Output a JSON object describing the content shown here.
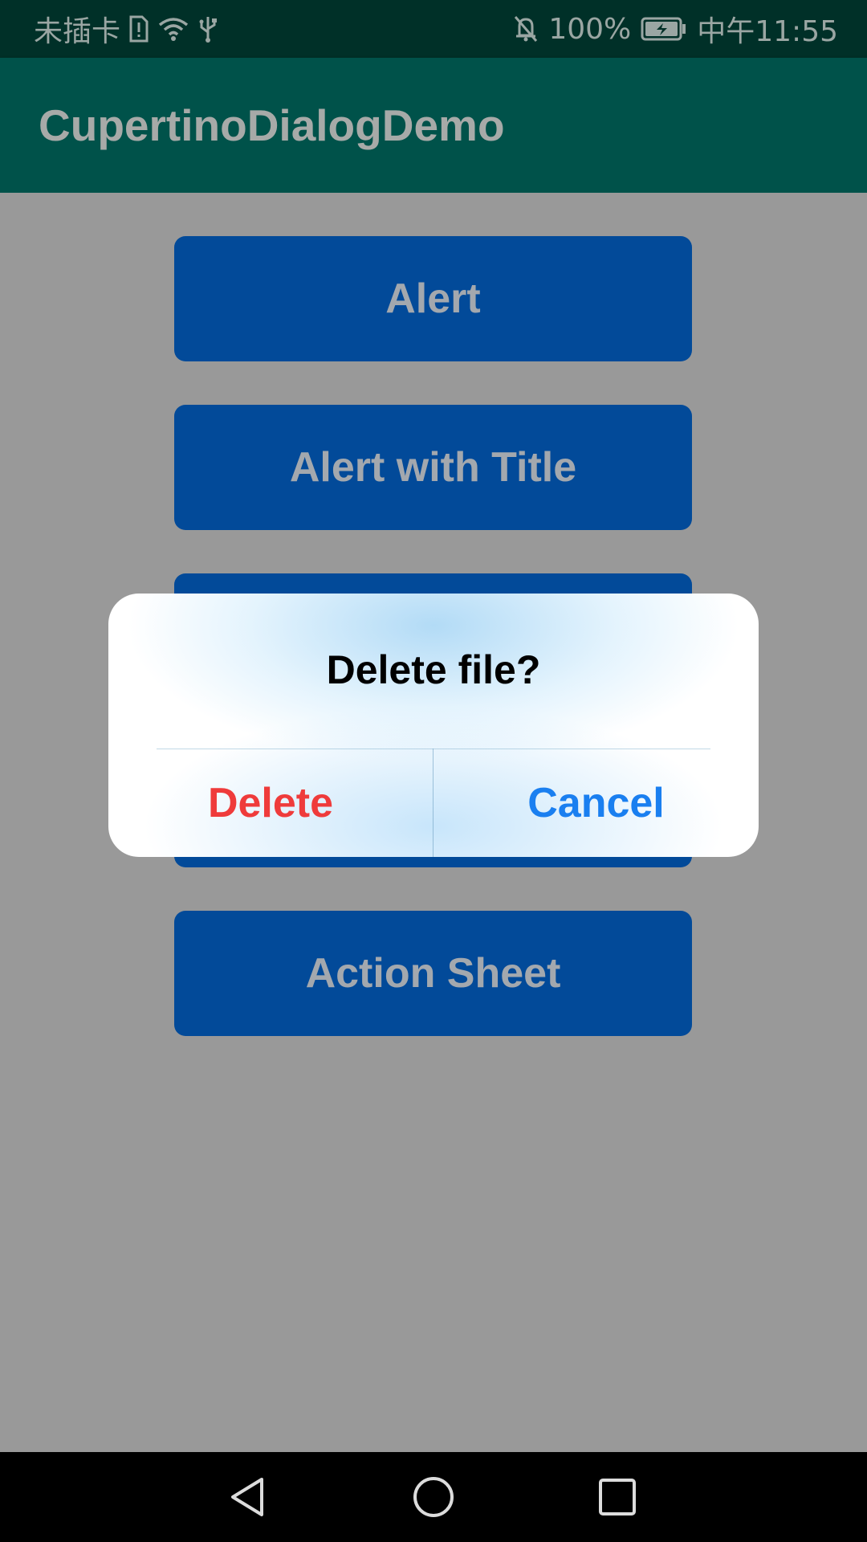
{
  "status_bar": {
    "carrier": "未插卡",
    "battery_percent": "100%",
    "time": "中午11:55",
    "icons": [
      "sim-alert-icon",
      "wifi-icon",
      "usb-icon",
      "bell-off-icon",
      "battery-charging-icon"
    ]
  },
  "app_bar": {
    "title": "CupertinoDialogDemo"
  },
  "buttons": {
    "alert": "Alert",
    "alert_with_title": "Alert with Title",
    "action_sheet": "Action Sheet"
  },
  "dialog": {
    "title": "Delete file?",
    "delete_label": "Delete",
    "cancel_label": "Cancel"
  },
  "colors": {
    "accent_blue": "#1a7ff0",
    "destructive_red": "#ef3b3b",
    "button_fill": "#024a99",
    "app_bar": "#00524a"
  },
  "nav_bar": {
    "icons": [
      "back-triangle-icon",
      "home-circle-icon",
      "recents-square-icon"
    ]
  }
}
